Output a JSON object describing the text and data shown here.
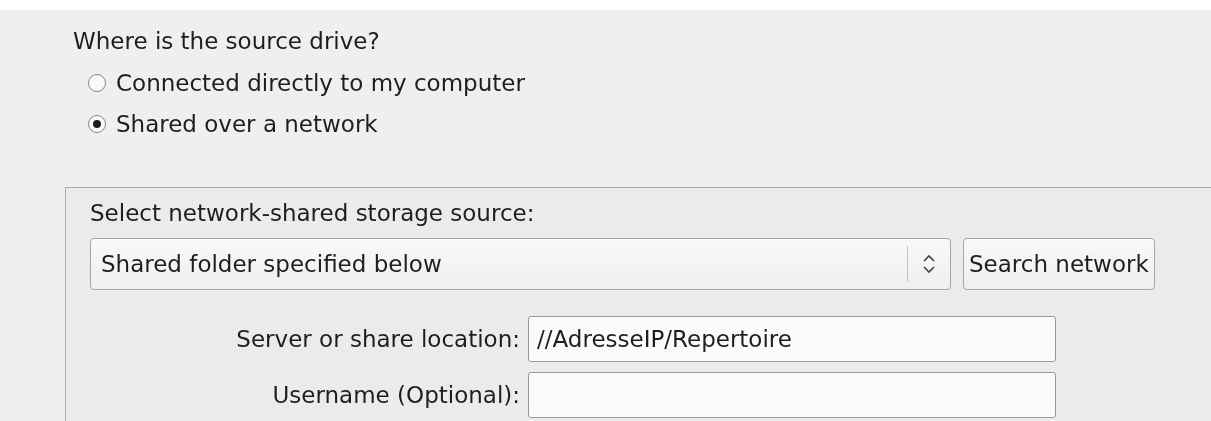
{
  "question": "Where is the source drive?",
  "options": [
    {
      "label": "Connected directly to my computer",
      "selected": false
    },
    {
      "label": "Shared over a network",
      "selected": true
    }
  ],
  "network_panel": {
    "title": "Select network-shared storage source:",
    "source_dropdown": {
      "value": "Shared folder specified below"
    },
    "search_button": "Search network",
    "fields": [
      {
        "label": "Server or share location:",
        "value": "//AdresseIP/Repertoire"
      },
      {
        "label": "Username (Optional):"
      }
    ]
  }
}
